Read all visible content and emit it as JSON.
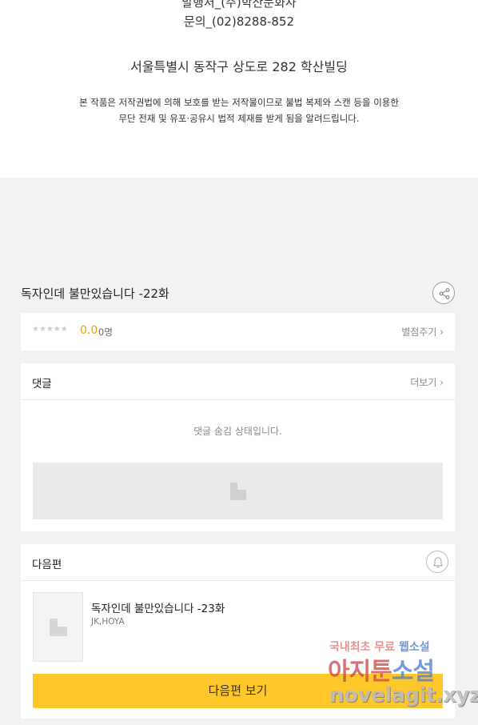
{
  "copyright": {
    "publisher_line": "발행처_(주)학산문화사",
    "contact_line": "문의_(02)8288-852",
    "address": "서울특별시 동작구 상도로 282 학산빌딩",
    "notice_line1": "본 작품은 저작권법에 의해 보호를 받는 저작물이므로 불법 복제와 스캔 등을 이용한",
    "notice_line2": "무단 전재 및 유포·공유시 법적 제재를 받게 됨을 알려드립니다."
  },
  "episode": {
    "title": "독자인데 불만있습니다 -22화",
    "share_icon": "share-icon"
  },
  "rating": {
    "stars": "★★★★★",
    "score": "0.0",
    "count": "0명",
    "rate_link": "별점주기 ›"
  },
  "comments": {
    "title": "댓글",
    "more_link": "더보기 ›",
    "hidden_message": "댓글 숨김 상태입니다."
  },
  "next": {
    "title": "다음편",
    "bell_icon": "bell-icon",
    "episode_title": "독자인데 불만있습니다 -23화",
    "author": "JK,HOYA",
    "button_label": "다음편 보기",
    "button_color": "#ffc82a"
  },
  "watermark": {
    "line1_a": "국내최초 무료",
    "line1_b": "웹소설",
    "line2_a": "아지툰",
    "line2_b": "소설",
    "line3": "novelagit.xyz"
  }
}
